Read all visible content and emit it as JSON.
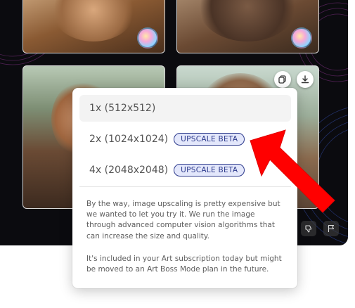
{
  "options": [
    {
      "label": "1x (512x512)",
      "badge": ""
    },
    {
      "label": "2x (1024x1024)",
      "badge": "UPSCALE BETA"
    },
    {
      "label": "4x (2048x2048)",
      "badge": "UPSCALE BETA"
    }
  ],
  "info": {
    "paragraph1": "By the way, image upscaling is pretty expensive but we wanted to let you try it. We run the image through advanced computer vision algorithms that can increase the size and quality.",
    "paragraph2": "It's included in your Art subscription today but might be moved to an Art Boss Mode plan in the future."
  },
  "icons": {
    "copy": "copy-icon",
    "download": "download-icon",
    "dislike": "thumbs-down-icon",
    "flag": "flag-icon",
    "avatar": "ai-avatar-icon"
  },
  "colors": {
    "badge_text": "#2d3a8c",
    "badge_bg": "#e3e7fb",
    "arrow": "#ff0000",
    "gallery_bg": "#0b0b0f"
  }
}
